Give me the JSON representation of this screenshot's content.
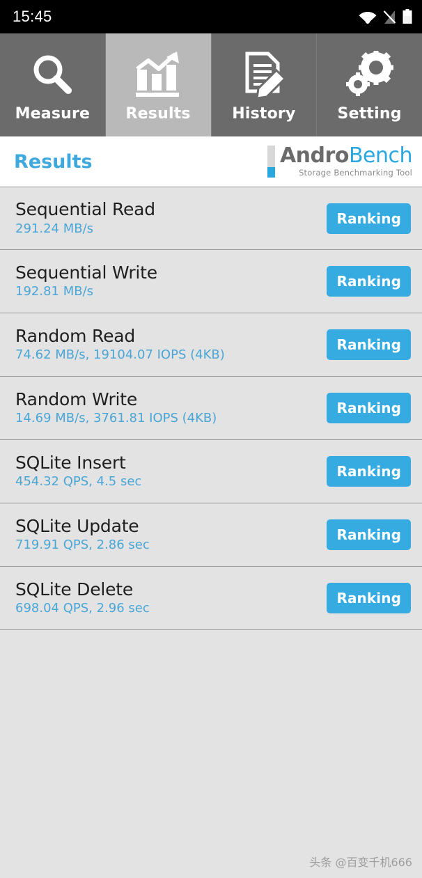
{
  "status_bar": {
    "time": "15:45",
    "icons": [
      "wifi-icon",
      "cellular-signal-off-icon",
      "battery-icon"
    ]
  },
  "tabs": [
    {
      "label": "Measure",
      "icon": "magnifier-icon",
      "active": false
    },
    {
      "label": "Results",
      "icon": "bar-chart-trend-icon",
      "active": true
    },
    {
      "label": "History",
      "icon": "document-pencil-icon",
      "active": false
    },
    {
      "label": "Setting",
      "icon": "gears-icon",
      "active": false
    }
  ],
  "header": {
    "title": "Results",
    "logo": {
      "name_part1": "Andro",
      "name_part2": "Bench",
      "tagline": "Storage Benchmarking Tool"
    }
  },
  "results": [
    {
      "name": "Sequential Read",
      "value": "291.24 MB/s",
      "button": "Ranking"
    },
    {
      "name": "Sequential Write",
      "value": "192.81 MB/s",
      "button": "Ranking"
    },
    {
      "name": "Random Read",
      "value": "74.62 MB/s, 19104.07 IOPS (4KB)",
      "button": "Ranking"
    },
    {
      "name": "Random Write",
      "value": "14.69 MB/s, 3761.81 IOPS (4KB)",
      "button": "Ranking"
    },
    {
      "name": "SQLite Insert",
      "value": "454.32 QPS, 4.5 sec",
      "button": "Ranking"
    },
    {
      "name": "SQLite Update",
      "value": "719.91 QPS, 2.86 sec",
      "button": "Ranking"
    },
    {
      "name": "SQLite Delete",
      "value": "698.04 QPS, 2.96 sec",
      "button": "Ranking"
    }
  ],
  "watermark": "头条 @百变千机666",
  "colors": {
    "accent_blue": "#35abe2",
    "title_blue": "#3fa9dd",
    "value_blue": "#4aa6d6",
    "list_bg": "#e3e3e3",
    "tab_bg": "#6b6b6b",
    "tab_active_bg": "#b9b9b9",
    "status_bg": "#000000"
  }
}
